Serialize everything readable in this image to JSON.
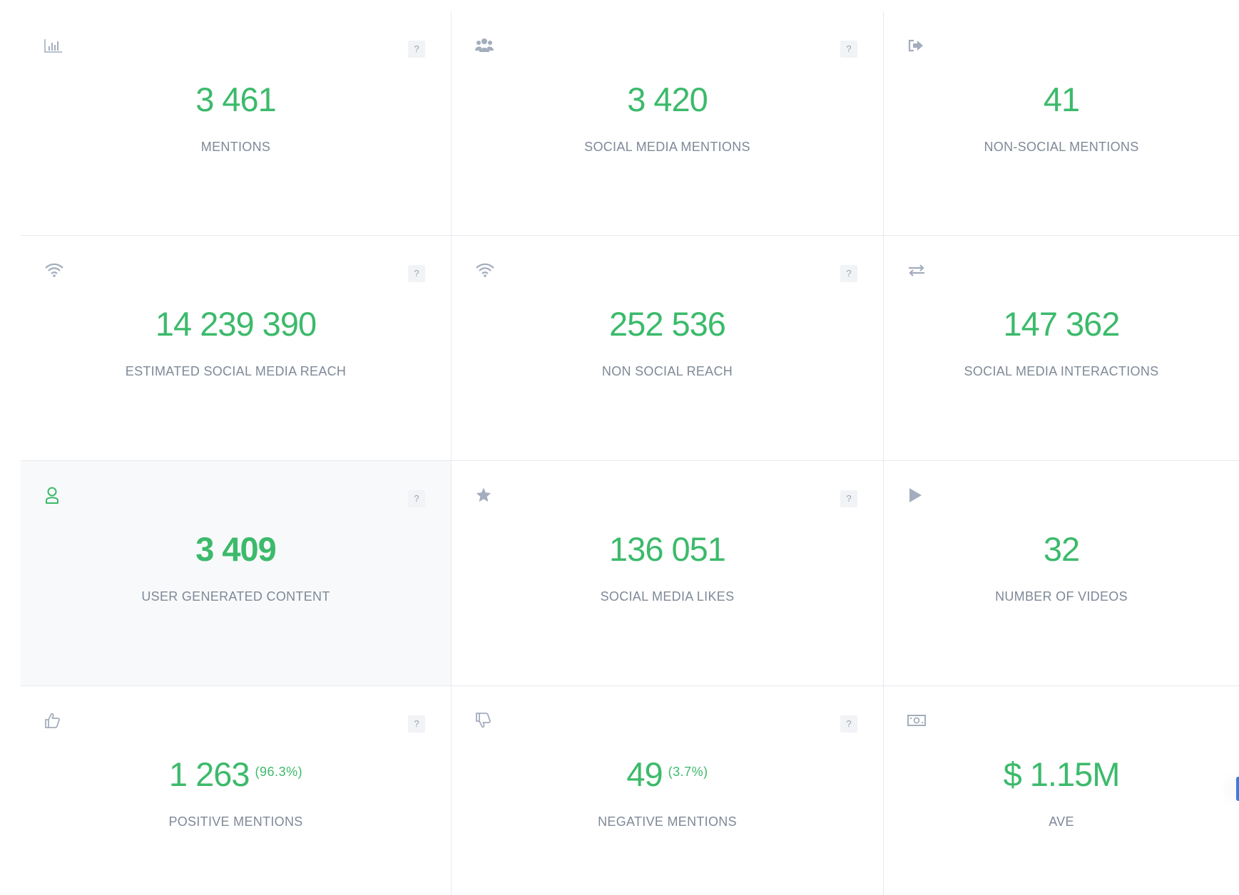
{
  "help_label": "?",
  "colors": {
    "value_green": "#3cba6b",
    "label_gray": "#7f8997",
    "icon_gray": "#a3adbd",
    "highlight_bg": "#f8f9fa",
    "divider": "#e6e9ee"
  },
  "tiles": [
    {
      "icon": "bar-chart-icon",
      "value": "3 461",
      "label": "MENTIONS"
    },
    {
      "icon": "users-icon",
      "value": "3 420",
      "label": "SOCIAL MEDIA MENTIONS"
    },
    {
      "icon": "sign-out-icon",
      "value": "41",
      "label": "NON-SOCIAL MENTIONS"
    },
    {
      "icon": "wifi-icon",
      "value": "14 239 390",
      "label": "ESTIMATED SOCIAL MEDIA REACH"
    },
    {
      "icon": "wifi-icon",
      "value": "252 536",
      "label": "NON SOCIAL REACH"
    },
    {
      "icon": "exchange-icon",
      "value": "147 362",
      "label": "SOCIAL MEDIA INTERACTIONS"
    },
    {
      "icon": "user-icon",
      "value": "3 409",
      "label": "USER GENERATED CONTENT"
    },
    {
      "icon": "star-icon",
      "value": "136 051",
      "label": "SOCIAL MEDIA LIKES"
    },
    {
      "icon": "play-icon",
      "value": "32",
      "label": "NUMBER OF VIDEOS"
    },
    {
      "icon": "thumbs-up-icon",
      "value": "1 263",
      "percent": "(96.3%)",
      "label": "POSITIVE MENTIONS"
    },
    {
      "icon": "thumbs-down-icon",
      "value": "49",
      "percent": "(3.7%)",
      "label": "NEGATIVE MENTIONS"
    },
    {
      "icon": "money-icon",
      "value": "$ 1.15M",
      "label": "AVE"
    }
  ]
}
